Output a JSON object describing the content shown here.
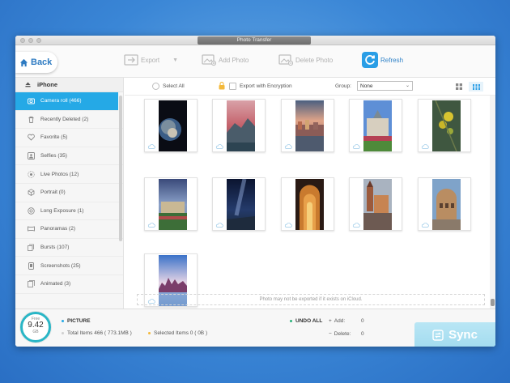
{
  "window": {
    "title": "Photo Transfer"
  },
  "toolbar": {
    "back_label": "Back",
    "export_label": "Export",
    "add_photo_label": "Add Photo",
    "delete_photo_label": "Delete Photo",
    "refresh_label": "Refresh"
  },
  "sidebar": {
    "device": "iPhone",
    "items": [
      {
        "label": "Camera roll (466)",
        "icon": "camera-icon"
      },
      {
        "label": "Recently Deleted (2)",
        "icon": "trash-icon"
      },
      {
        "label": "Favorite (5)",
        "icon": "heart-icon"
      },
      {
        "label": "Selfies (35)",
        "icon": "person-icon"
      },
      {
        "label": "Live Photos (12)",
        "icon": "live-icon"
      },
      {
        "label": "Portrait (0)",
        "icon": "cube-icon"
      },
      {
        "label": "Long Exposure (1)",
        "icon": "exposure-icon"
      },
      {
        "label": "Panoramas (2)",
        "icon": "panorama-icon"
      },
      {
        "label": "Bursts (107)",
        "icon": "burst-icon"
      },
      {
        "label": "Screenshots (25)",
        "icon": "screenshot-icon"
      },
      {
        "label": "Animated (3)",
        "icon": "animated-icon"
      }
    ]
  },
  "subbar": {
    "select_all": "Select All",
    "export_encryption": "Export with Encryption",
    "group_label": "Group:",
    "group_value": "None"
  },
  "notice": "Photo may not be exported if it exists on iCloud.",
  "footer": {
    "free_label": "Free",
    "free_value": "9.42",
    "free_unit": "GB",
    "category": "PICTURE",
    "total_items": "Total Items 466 ( 773.1MB )",
    "selected_items": "Selected Items 0 ( 0B )",
    "undo_all": "UNDO ALL",
    "add_label": "Add:",
    "add_value": "0",
    "delete_label": "Delete:",
    "delete_value": "0",
    "sync_label": "Sync"
  },
  "colors": {
    "accent": "#25a9e6",
    "sync_button": "#a8def0",
    "storage_ring": "#29b6c6"
  }
}
